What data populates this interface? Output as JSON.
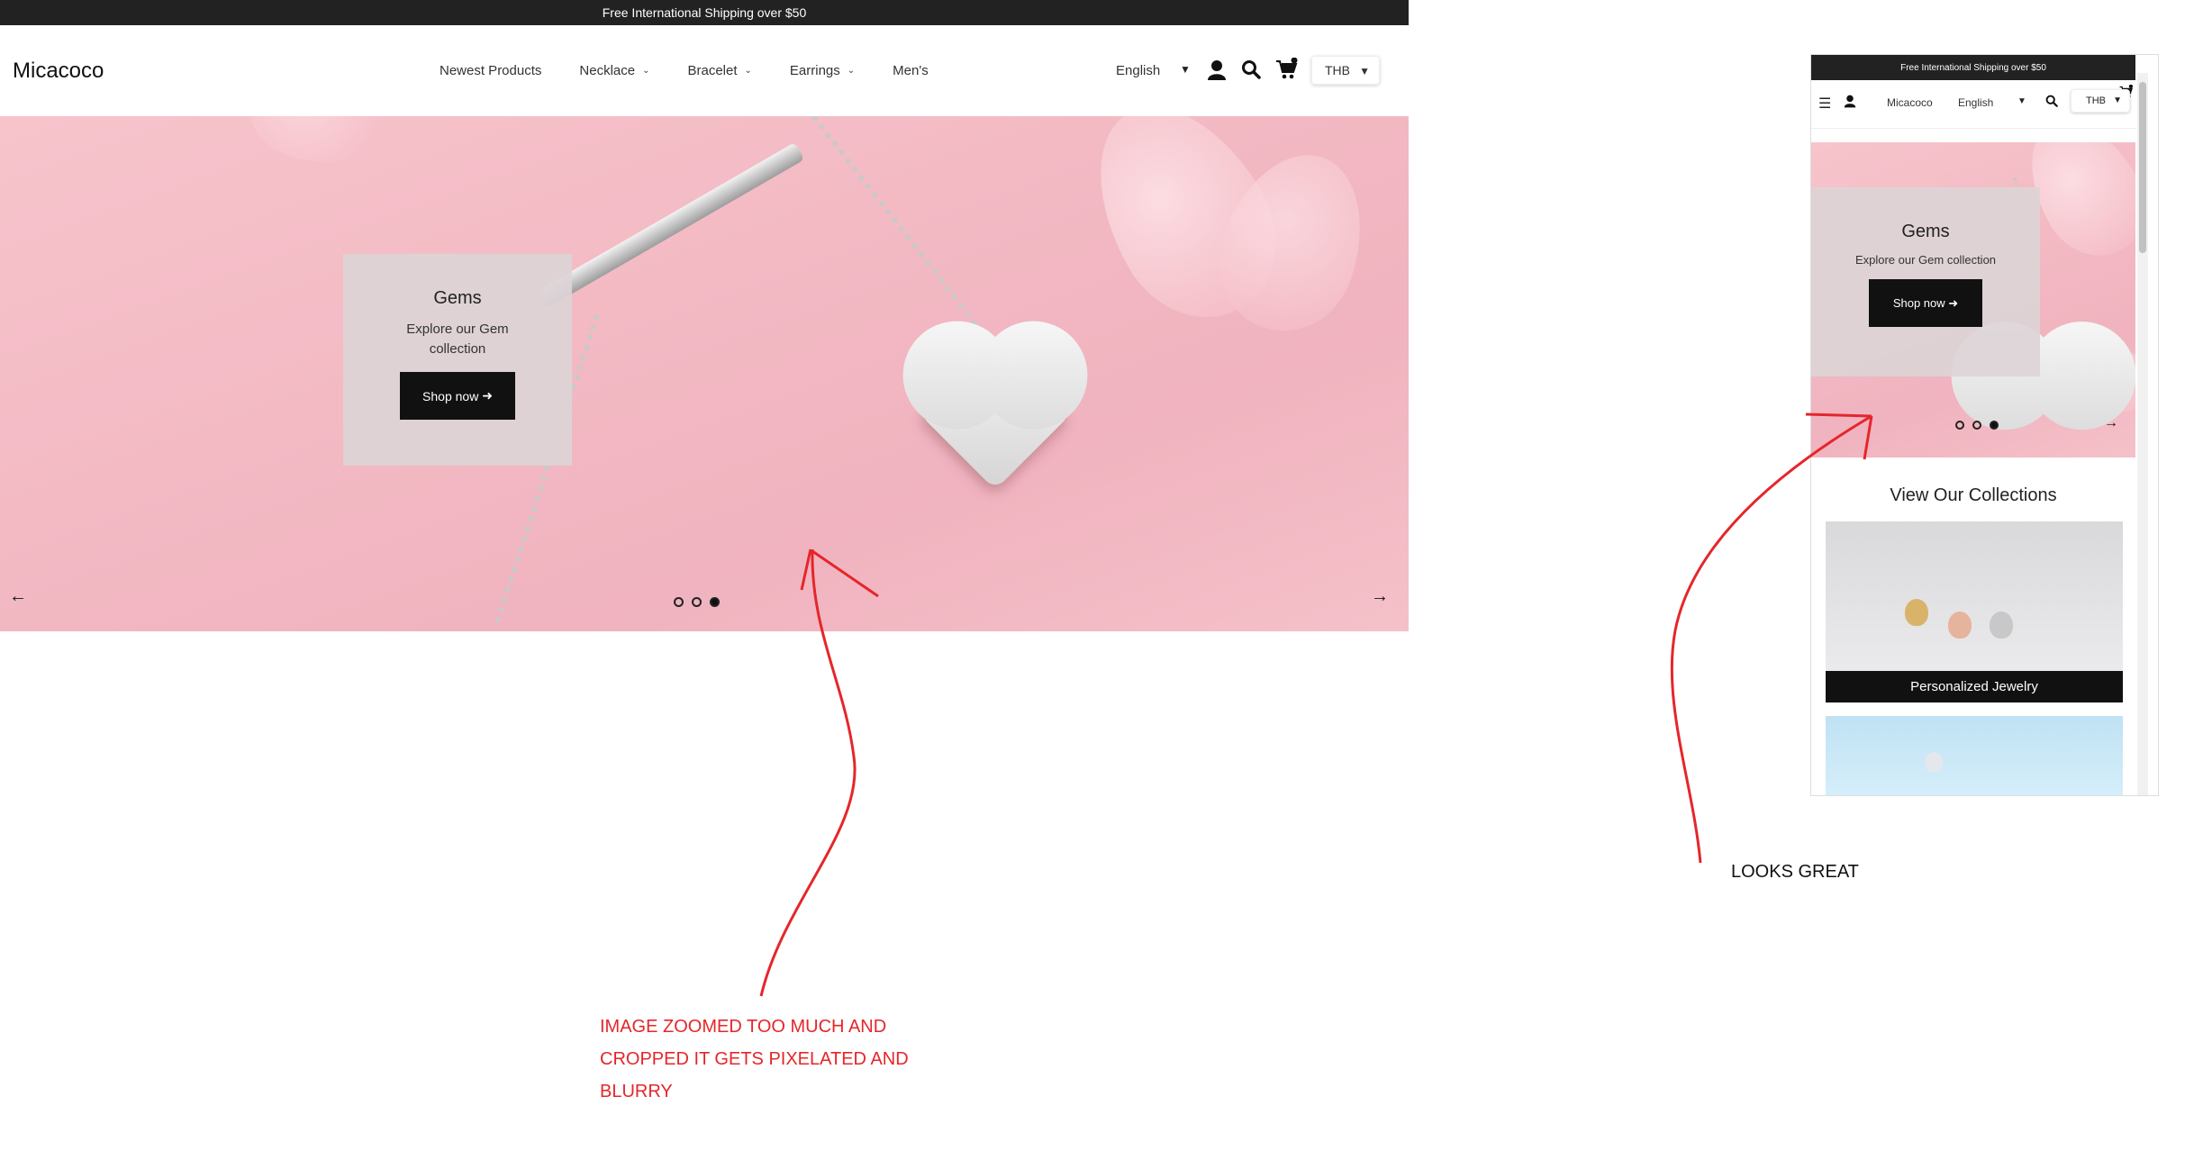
{
  "desktop": {
    "shipping_banner": "Free International Shipping over $50",
    "logo": "Micacoco",
    "menu": [
      {
        "label": "Newest Products",
        "has_dropdown": false
      },
      {
        "label": "Necklace",
        "has_dropdown": true
      },
      {
        "label": "Bracelet",
        "has_dropdown": true
      },
      {
        "label": "Earrings",
        "has_dropdown": true
      },
      {
        "label": "Men's",
        "has_dropdown": false
      }
    ],
    "language": "English",
    "currency": "THB",
    "hero": {
      "title": "Gems",
      "subtitle": "Explore our Gem collection",
      "button": "Shop now",
      "slide_count": 3,
      "active_slide": 3
    }
  },
  "mobile": {
    "shipping_banner": "Free International Shipping over $50",
    "logo": "Micacoco",
    "language": "English",
    "currency": "THB",
    "hero": {
      "title": "Gems",
      "subtitle": "Explore our Gem collection",
      "button": "Shop now",
      "slide_count": 3,
      "active_slide": 3
    },
    "collections_title": "View Our Collections",
    "collections": [
      {
        "label": "Personalized Jewelry"
      }
    ]
  },
  "annotations": {
    "left_lines": [
      "IMAGE ZOOMED TOO MUCH AND",
      "CROPPED IT GETS PIXELATED AND",
      "BLURRY"
    ],
    "right": "LOOKS GREAT"
  },
  "colors": {
    "shipping_bar_bg": "#222222",
    "hero_pink": "#f3bac4",
    "button_bg": "#111111",
    "annotation_red": "#e5262a"
  },
  "icons": [
    "user-icon",
    "search-icon",
    "cart-icon",
    "chevron-down-icon",
    "arrow-right-icon",
    "arrow-left-icon",
    "hamburger-icon"
  ]
}
